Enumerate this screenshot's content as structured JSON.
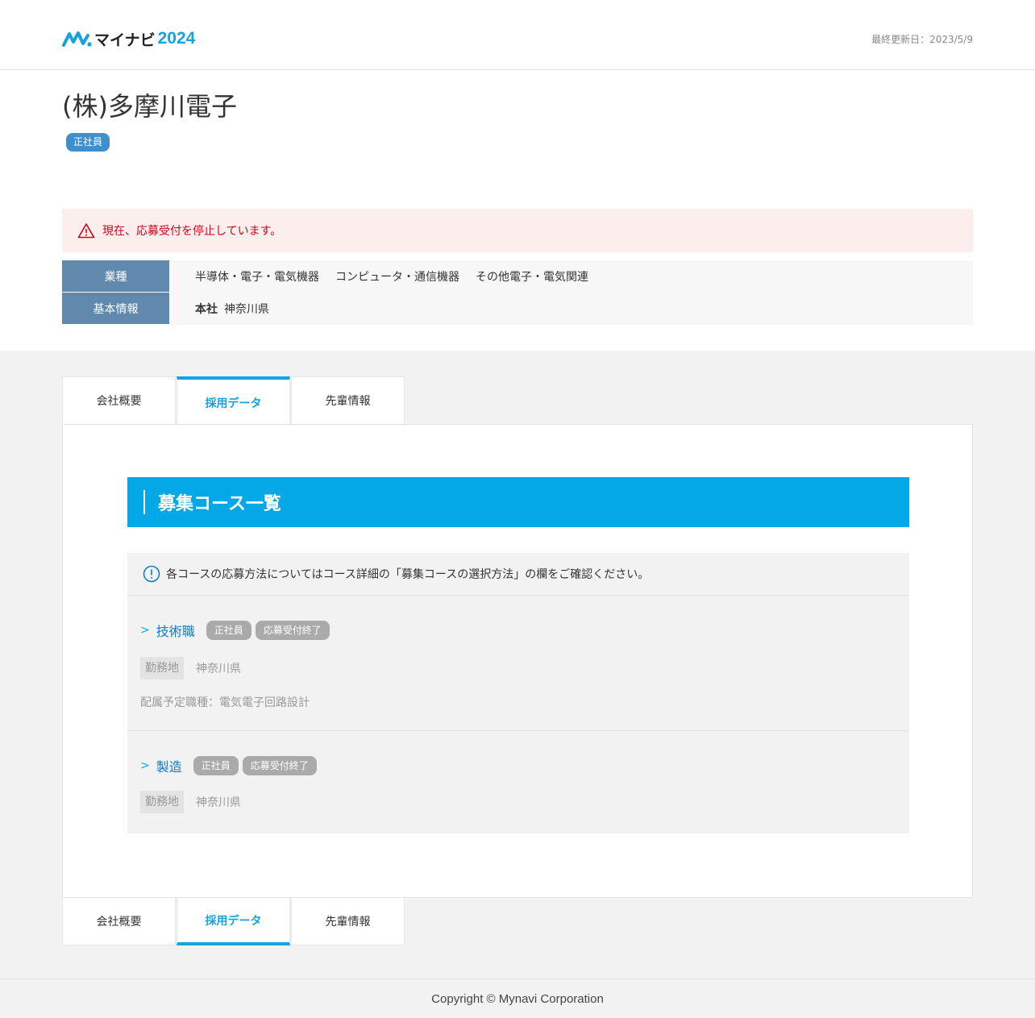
{
  "header": {
    "logo_name": "マイナビ",
    "logo_year": "2024",
    "updated": "最終更新日：2023/5/9"
  },
  "company": {
    "name": "(株)多摩川電子",
    "employment_badge": "正社員"
  },
  "alert": {
    "text": "現在、応募受付を停止しています。"
  },
  "info": {
    "industry_label": "業種",
    "industries": [
      "半導体・電子・電気機器",
      "コンピュータ・通信機器",
      "その他電子・電気関連"
    ],
    "basic_label": "基本情報",
    "hq_label": "本社",
    "hq_value": "神奈川県"
  },
  "tabs": [
    {
      "label": "会社概要",
      "active": false
    },
    {
      "label": "採用データ",
      "active": true
    },
    {
      "label": "先輩情報",
      "active": false
    }
  ],
  "section": {
    "title": "募集コース一覧",
    "notice": "各コースの応募方法についてはコース詳細の「募集コースの選択方法」の欄をご確認ください。"
  },
  "courses": [
    {
      "name": "技術職",
      "badges": [
        "正社員",
        "応募受付終了"
      ],
      "location_label": "勤務地",
      "location": "神奈川県",
      "assignment": "配属予定職種：電気電子回路設計"
    },
    {
      "name": "製造",
      "badges": [
        "正社員",
        "応募受付終了"
      ],
      "location_label": "勤務地",
      "location": "神奈川県"
    }
  ],
  "footer": {
    "copyright": "Copyright © Mynavi Corporation"
  },
  "colors": {
    "brand": "#14a3e0",
    "alert": "#d0021b",
    "label_bg": "#6188ad",
    "badge": "#3d8fce"
  }
}
